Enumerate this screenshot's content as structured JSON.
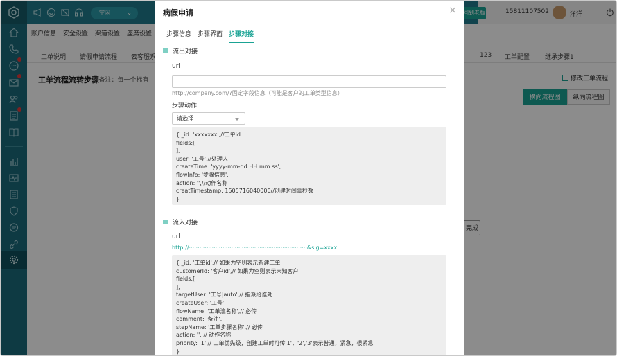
{
  "topbar": {
    "status_label": "空闲",
    "old_version_label": "回到老版",
    "phone": "15811107502",
    "user_name": "洋洋"
  },
  "menu": {
    "items": [
      "账户信息",
      "安全设置",
      "渠道设置",
      "座席设置"
    ]
  },
  "subtabs": {
    "left": [
      "工单说明",
      "请假申请流程",
      "云客服系"
    ],
    "right": [
      "123",
      "工单配置",
      "继承步骤1"
    ]
  },
  "flow": {
    "title": "工单流程流转步骤",
    "note": "(备注：每一个标有",
    "edit_label": "修改工单流程",
    "horizontal_label": "横向流程图",
    "vertical_label": "纵向流程图",
    "done_label": "完成"
  },
  "modal": {
    "title": "病假申请",
    "close_icon": "close-icon",
    "tabs": [
      "步骤信息",
      "步骤界面",
      "步骤对接"
    ],
    "active_tab": 2,
    "out_section": {
      "heading": "流出对接",
      "url_label": "url",
      "url_value": "",
      "url_hint": "http://company.com/?固定字段信息（可能是客户的工单类型信息）",
      "action_label": "步骤动作",
      "action_select_value": "请选择",
      "code_lines": [
        "{ _id: 'xxxxxxx',//工单id",
        "fields:[",
        "],",
        "user: '工号',//处理人",
        "createTime: 'yyyy-mm-dd HH:mm:ss',",
        "flowInfo: '步骤信息',",
        "action: '',//动作名称",
        "creatTimestamp: 1505716040000//创建时间毫秒数",
        "}"
      ]
    },
    "in_section": {
      "heading": "流入对接",
      "url_label": "url",
      "url_value": "http://··· ·······························································&sig=xxxx",
      "code_lines": [
        "{ _id: '工单id',// 如果为空则表示新建工单",
        "customerId: '客户id',// 如果为空则表示未知客户",
        "fields:[",
        "],",
        "targetUser: '工号|auto',// 指派给谁处",
        "createUser: '工号',",
        "flowName: '工单流名称',// 必传",
        "comment: '备注',",
        "stepName: '工单步骤名称',// 必传",
        "action: '', // 动作名称",
        "priority: '1' // 工单优先级，创建工单时可传'1'，'2','3'表示普通，紧急，很紧急",
        "}"
      ]
    }
  },
  "colors": {
    "accent": "#1aa394",
    "sidebar": "#1b6a7a",
    "topbar": "#1f7a8c"
  }
}
